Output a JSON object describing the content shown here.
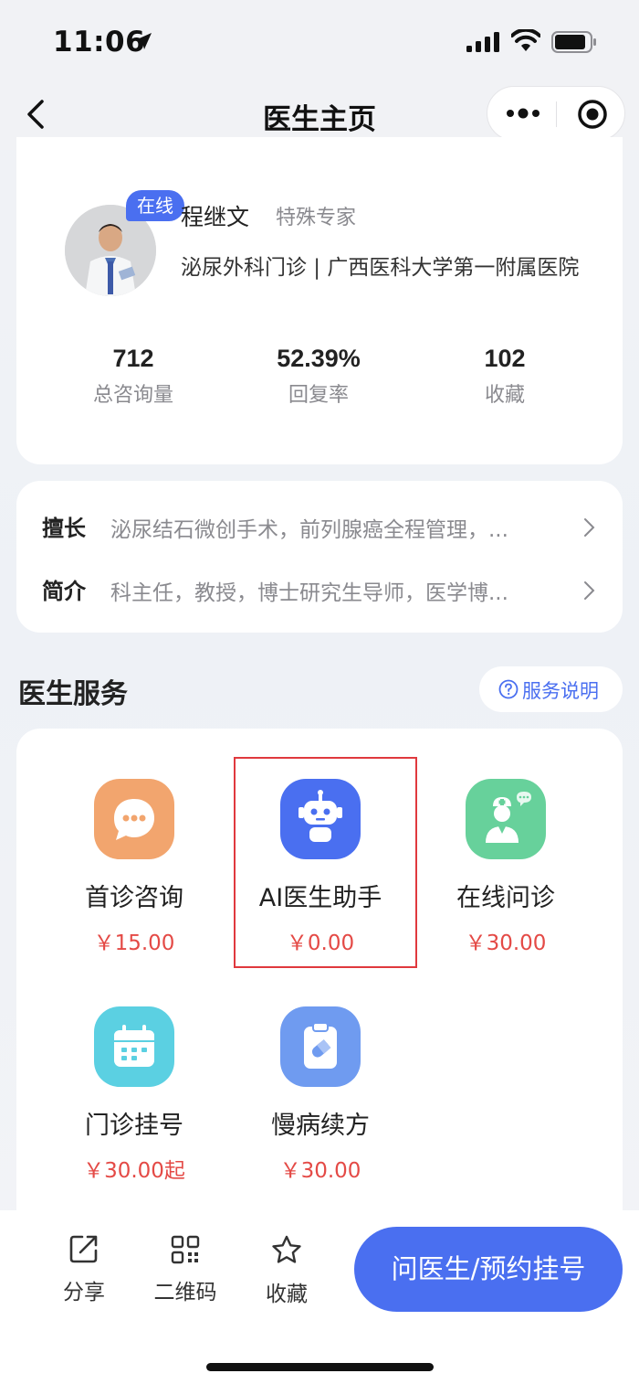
{
  "status_bar": {
    "time": "11:06"
  },
  "nav": {
    "title": "医生主页"
  },
  "doctor": {
    "online_badge": "在线",
    "name": "程继文",
    "title": "特殊专家",
    "department": "泌尿外科门诊 | 广西医科大学第一附属医院",
    "stats": [
      {
        "value": "712",
        "label": "总咨询量"
      },
      {
        "value": "52.39%",
        "label": "回复率"
      },
      {
        "value": "102",
        "label": "收藏"
      }
    ]
  },
  "info": {
    "specialty": {
      "key": "擅长",
      "value": "泌尿结石微创手术，前列腺癌全程管理，..."
    },
    "intro": {
      "key": "简介",
      "value": "科主任，教授，博士研究生导师，医学博..."
    }
  },
  "services": {
    "title": "医生服务",
    "note": "服务说明",
    "items": [
      {
        "label": "首诊咨询",
        "price": "￥15.00",
        "icon": "chat-bubble-icon",
        "color": "#f2a56e"
      },
      {
        "label": "AI医生助手",
        "price": "￥0.00",
        "icon": "robot-icon",
        "color": "#4a6ff0"
      },
      {
        "label": "在线问诊",
        "price": "￥30.00",
        "icon": "nurse-icon",
        "color": "#67d19b"
      },
      {
        "label": "门诊挂号",
        "price": "￥30.00起",
        "icon": "calendar-icon",
        "color": "#5bd0e2"
      },
      {
        "label": "慢病续方",
        "price": "￥30.00",
        "icon": "prescription-icon",
        "color": "#6f9bf0"
      }
    ]
  },
  "bottom_bar": {
    "share": "分享",
    "qrcode": "二维码",
    "favorite": "收藏",
    "ask_button": "问医生/预约挂号"
  }
}
